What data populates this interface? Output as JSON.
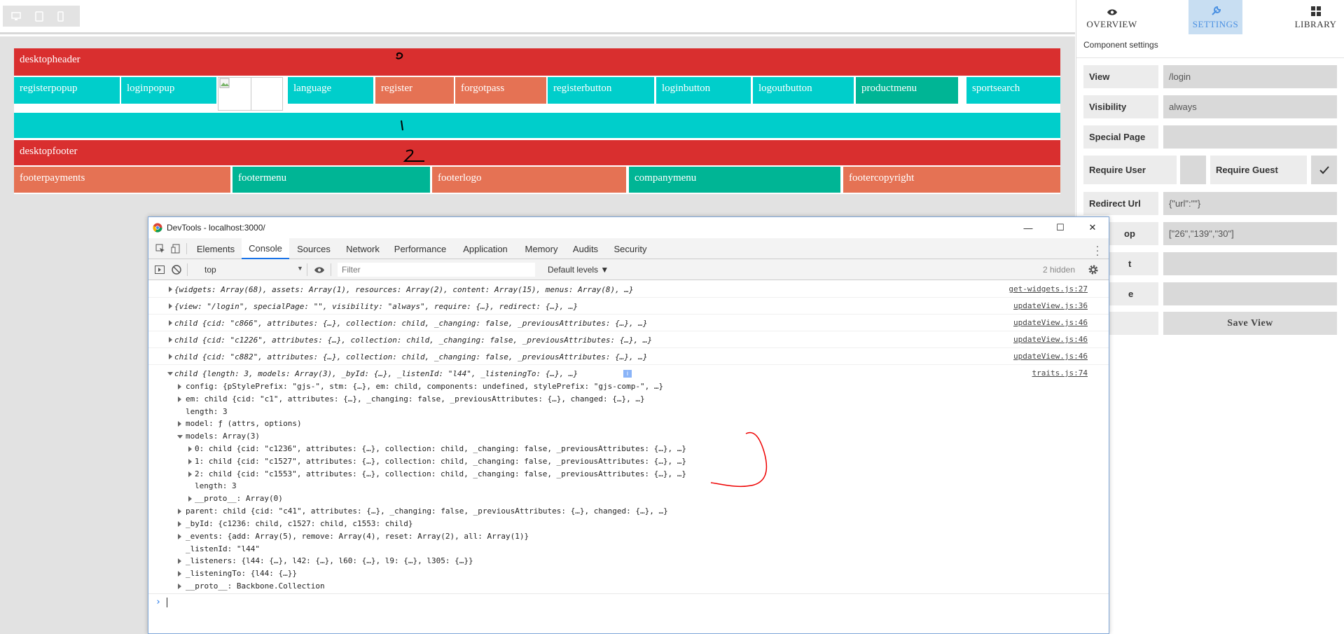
{
  "builder": {
    "device_buttons": [
      "desktop-icon",
      "tablet-icon",
      "mobile-icon"
    ],
    "header_row": {
      "label": "desktopheader"
    },
    "header_widgets": [
      {
        "label": "registerpopup",
        "color": "cyan"
      },
      {
        "label": "loginpopup",
        "color": "cyan"
      },
      {
        "label": "",
        "color": "image"
      },
      {
        "label": "language",
        "color": "cyan"
      },
      {
        "label": "register",
        "color": "salmon"
      },
      {
        "label": "forgotpass",
        "color": "salmon"
      },
      {
        "label": "registerbutton",
        "color": "cyan"
      },
      {
        "label": "loginbutton",
        "color": "cyan"
      },
      {
        "label": "logoutbutton",
        "color": "cyan"
      },
      {
        "label": "productmenu",
        "color": "teal"
      },
      {
        "label": "sportsearch",
        "color": "cyan"
      }
    ],
    "footer_row": {
      "label": "desktopfooter"
    },
    "footer_widgets": [
      {
        "label": "footerpayments",
        "color": "salmon"
      },
      {
        "label": "footermenu",
        "color": "teal"
      },
      {
        "label": "footerlogo",
        "color": "salmon"
      },
      {
        "label": "companymenu",
        "color": "teal"
      },
      {
        "label": "footercopyright",
        "color": "salmon"
      }
    ],
    "colors": {
      "red": "#d92f2f",
      "cyan": "#00cecb",
      "salmon": "#e57254",
      "teal": "#00b595"
    }
  },
  "panel": {
    "tabs": [
      {
        "label": "OVERVIEW",
        "icon": "eye-icon"
      },
      {
        "label": "SETTINGS",
        "icon": "wrench-icon",
        "active": true
      },
      {
        "label": "LIBRARY",
        "icon": "grid-icon"
      }
    ],
    "section_title": "Component settings",
    "fields": {
      "view": {
        "label": "View",
        "value": "/login"
      },
      "visibility": {
        "label": "Visibility",
        "value": "always"
      },
      "special_page": {
        "label": "Special Page",
        "value": ""
      },
      "require_user": {
        "label": "Require User"
      },
      "require_guest": {
        "label": "Require Guest",
        "checked": true
      },
      "redirect_url": {
        "label": "Redirect Url",
        "value": "{\"url\":\"\"}"
      },
      "pop": {
        "label": "op",
        "value": "[\"26\",\"139\",\"30\"]"
      },
      "t_field": {
        "label": "t",
        "value": ""
      },
      "e_field": {
        "label": "e",
        "value": ""
      }
    },
    "save_button": "Save View"
  },
  "devtools": {
    "title": "DevTools - localhost:3000/",
    "tabs": [
      "Elements",
      "Console",
      "Sources",
      "Network",
      "Performance",
      "Application",
      "Memory",
      "Audits",
      "Security"
    ],
    "active_tab": "Console",
    "context": "top",
    "filter_placeholder": "Filter",
    "levels": "Default levels ▼",
    "hidden": "2 hidden",
    "logs": [
      {
        "text": "{widgets: Array(68), assets: Array(1), resources: Array(2), content: Array(15), menus: Array(8), …}",
        "src": "get-widgets.js:27"
      },
      {
        "text": "{view: \"/login\", specialPage: \"\", visibility: \"always\", require: {…}, redirect: {…}, …}",
        "src": "updateView.js:36"
      },
      {
        "text": "child {cid: \"c866\", attributes: {…}, collection: child, _changing: false, _previousAttributes: {…}, …}",
        "src": "updateView.js:46"
      },
      {
        "text": "child {cid: \"c1226\", attributes: {…}, collection: child, _changing: false, _previousAttributes: {…}, …}",
        "src": "updateView.js:46"
      },
      {
        "text": "child {cid: \"c882\", attributes: {…}, collection: child, _changing: false, _previousAttributes: {…}, …}",
        "src": "updateView.js:46"
      }
    ],
    "expanded": {
      "head": "child {length: 3, models: Array(3), _byId: {…}, _listenId: \"l44\", _listeningTo: {…}, …}",
      "src": "traits.js:74",
      "props": [
        "config: {pStylePrefix: \"gjs-\", stm: {…}, em: child, components: undefined, stylePrefix: \"gjs-comp-\", …}",
        "em: child {cid: \"c1\", attributes: {…}, _changing: false, _previousAttributes: {…}, changed: {…}, …}",
        "length: 3",
        "model: ƒ (attrs, options)",
        "models: Array(3)",
        "0: child {cid: \"c1236\", attributes: {…}, collection: child, _changing: false, _previousAttributes: {…}, …}",
        "1: child {cid: \"c1527\", attributes: {…}, collection: child, _changing: false, _previousAttributes: {…}, …}",
        "2: child {cid: \"c1553\", attributes: {…}, collection: child, _changing: false, _previousAttributes: {…}, …}",
        "length: 3",
        "__proto__: Array(0)",
        "parent: child {cid: \"c41\", attributes: {…}, _changing: false, _previousAttributes: {…}, changed: {…}, …}",
        "_byId: {c1236: child, c1527: child, c1553: child}",
        "_events: {add: Array(5), remove: Array(4), reset: Array(2), all: Array(1)}",
        "_listenId: \"l44\"",
        "_listeners: {l44: {…}, l42: {…}, l60: {…}, l9: {…}, l305: {…}}",
        "_listeningTo: {l44: {…}}",
        "__proto__: Backbone.Collection"
      ]
    }
  }
}
